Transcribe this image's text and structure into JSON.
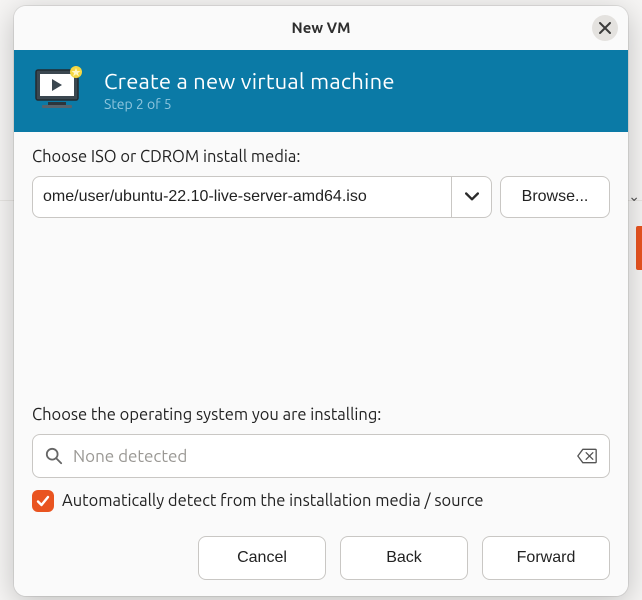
{
  "window": {
    "title": "New VM"
  },
  "banner": {
    "heading": "Create a new virtual machine",
    "step": "Step 2 of 5"
  },
  "media": {
    "label": "Choose ISO or CDROM install media:",
    "path": "ome/user/ubuntu-22.10-live-server-amd64.iso",
    "browse": "Browse..."
  },
  "os": {
    "label": "Choose the operating system you are installing:",
    "placeholder": "None detected"
  },
  "autodetect": {
    "label": "Automatically detect from the installation media / source",
    "checked": true
  },
  "buttons": {
    "cancel": "Cancel",
    "back": "Back",
    "forward": "Forward"
  }
}
